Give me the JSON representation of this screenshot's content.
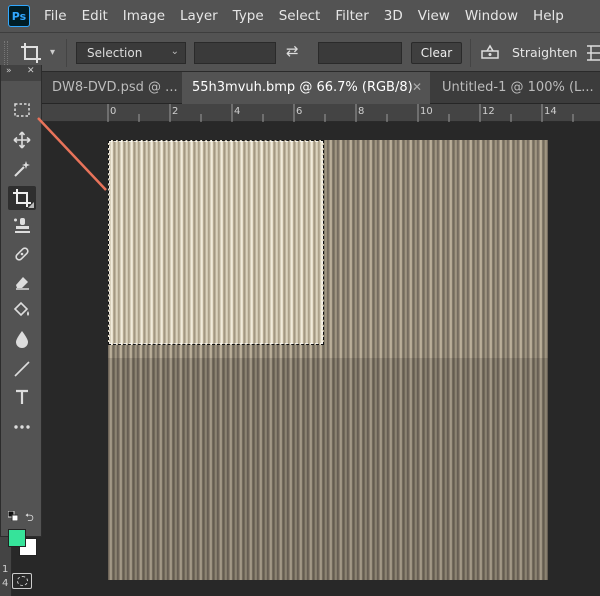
{
  "app": {
    "logo": "Ps"
  },
  "menu": [
    "File",
    "Edit",
    "Image",
    "Layer",
    "Type",
    "Select",
    "Filter",
    "3D",
    "View",
    "Window",
    "Help"
  ],
  "options": {
    "ratio_select": "Selection",
    "clear_label": "Clear",
    "straighten_label": "Straighten"
  },
  "tabs": [
    {
      "label": "DW8-DVD.psd @ ..."
    },
    {
      "label": "55h3mvuh.bmp @ 66.7% (RGB/8)"
    },
    {
      "label": "Untitled-1 @ 100% (L..."
    }
  ],
  "ruler": {
    "top": [
      "0",
      "2",
      "4",
      "6",
      "8",
      "10",
      "12",
      "14"
    ],
    "left": [
      "1",
      "4"
    ]
  },
  "colors": {
    "foreground": "#36e39a",
    "background": "#ffffff",
    "annotation_arrow": "#e8735a"
  }
}
